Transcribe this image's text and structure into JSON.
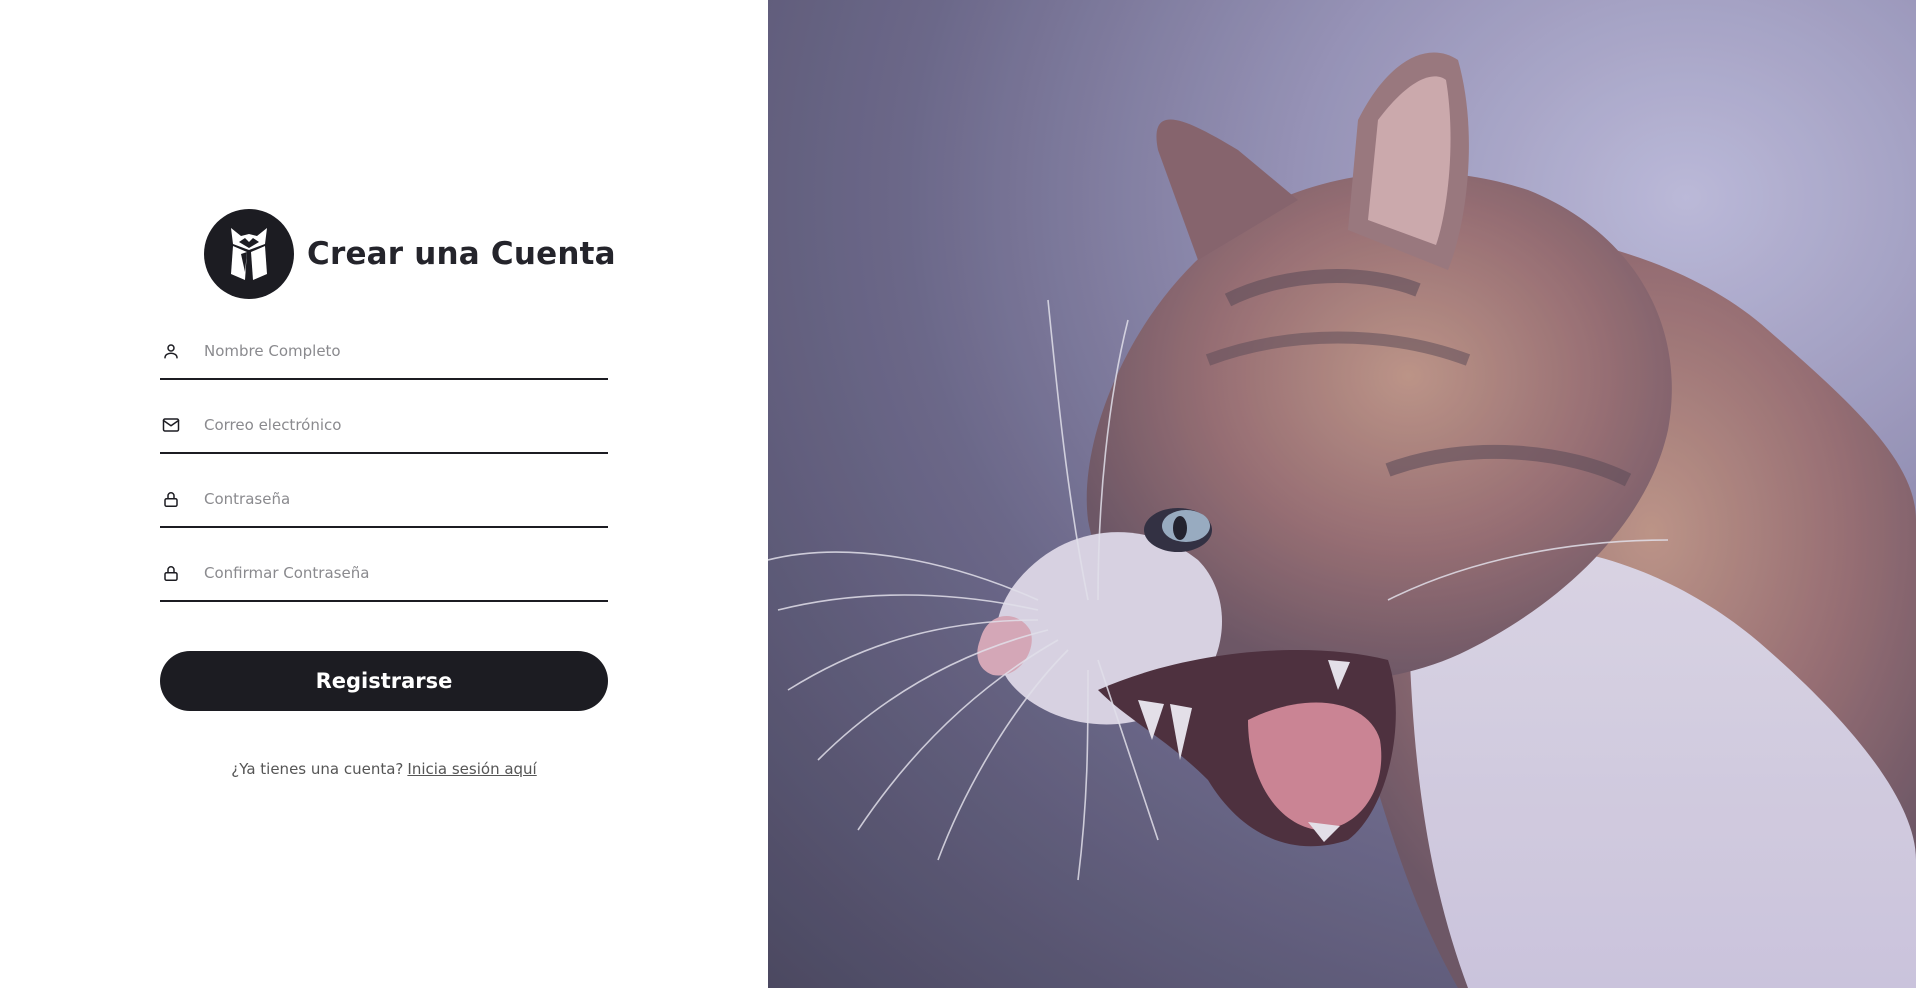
{
  "header": {
    "title": "Crear una Cuenta",
    "logo_icon": "fox-logo-icon"
  },
  "form": {
    "fields": [
      {
        "placeholder": "Nombre Completo",
        "value": "",
        "icon": "user-icon"
      },
      {
        "placeholder": "Correo electrónico",
        "value": "",
        "icon": "mail-icon"
      },
      {
        "placeholder": "Contraseña",
        "value": "",
        "icon": "lock-icon"
      },
      {
        "placeholder": "Confirmar Contraseña",
        "value": "",
        "icon": "lock-icon"
      }
    ],
    "submit_label": "Registrarse"
  },
  "footer": {
    "prompt": "¿Ya tienes una cuenta?",
    "link": "Inicia sesión aquí"
  },
  "hero": {
    "subject": "cat-hissing-photo"
  },
  "colors": {
    "primary": "#1c1c22",
    "background": "#ffffff",
    "hero_tint": "#8e8aae"
  }
}
